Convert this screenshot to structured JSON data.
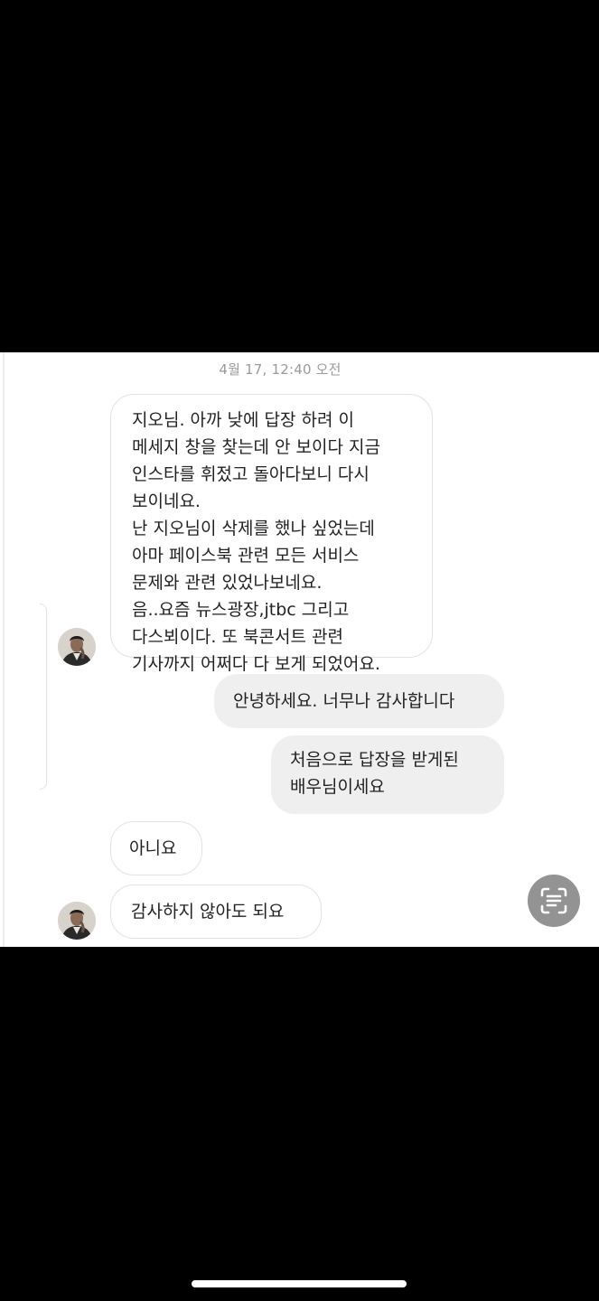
{
  "chat": {
    "timestamp": "4월 17, 12:40 오전",
    "messages": [
      {
        "sender": "other",
        "lines": [
          "지오님. 아까 낮에 답장 하려 이",
          "메세지 창을 찾는데 안 보이다 지금",
          "인스타를 휘젔고 돌아다보니 다시",
          "보이네요.",
          "난 지오님이 삭제를 했나 싶었는데",
          "아마 페이스북 관련 모든 서비스",
          "문제와 관련 있었나보네요.",
          "음..요즘 뉴스광장,jtbc 그리고",
          "다스뵈이다. 또 북콘서트 관련",
          "기사까지 어쩌다 다 보게 되었어요."
        ]
      },
      {
        "sender": "me",
        "lines": [
          "안녕하세요. 너무나 감사합니다"
        ]
      },
      {
        "sender": "me",
        "lines": [
          "처음으로 답장을 받게된",
          "배우님이세요"
        ]
      },
      {
        "sender": "other",
        "lines": [
          "아니요"
        ]
      },
      {
        "sender": "other",
        "lines": [
          "감사하지 않아도 되요"
        ]
      }
    ]
  },
  "icons": {
    "avatar": "profile-photo-avatar",
    "scan": "text-scan-icon"
  },
  "colors": {
    "background": "#000000",
    "chat_background": "#ffffff",
    "outgoing_bubble": "#efefef",
    "incoming_border": "#e2e2e2",
    "timestamp_text": "#9a9a9a",
    "scan_button": "#8a8a8a"
  }
}
